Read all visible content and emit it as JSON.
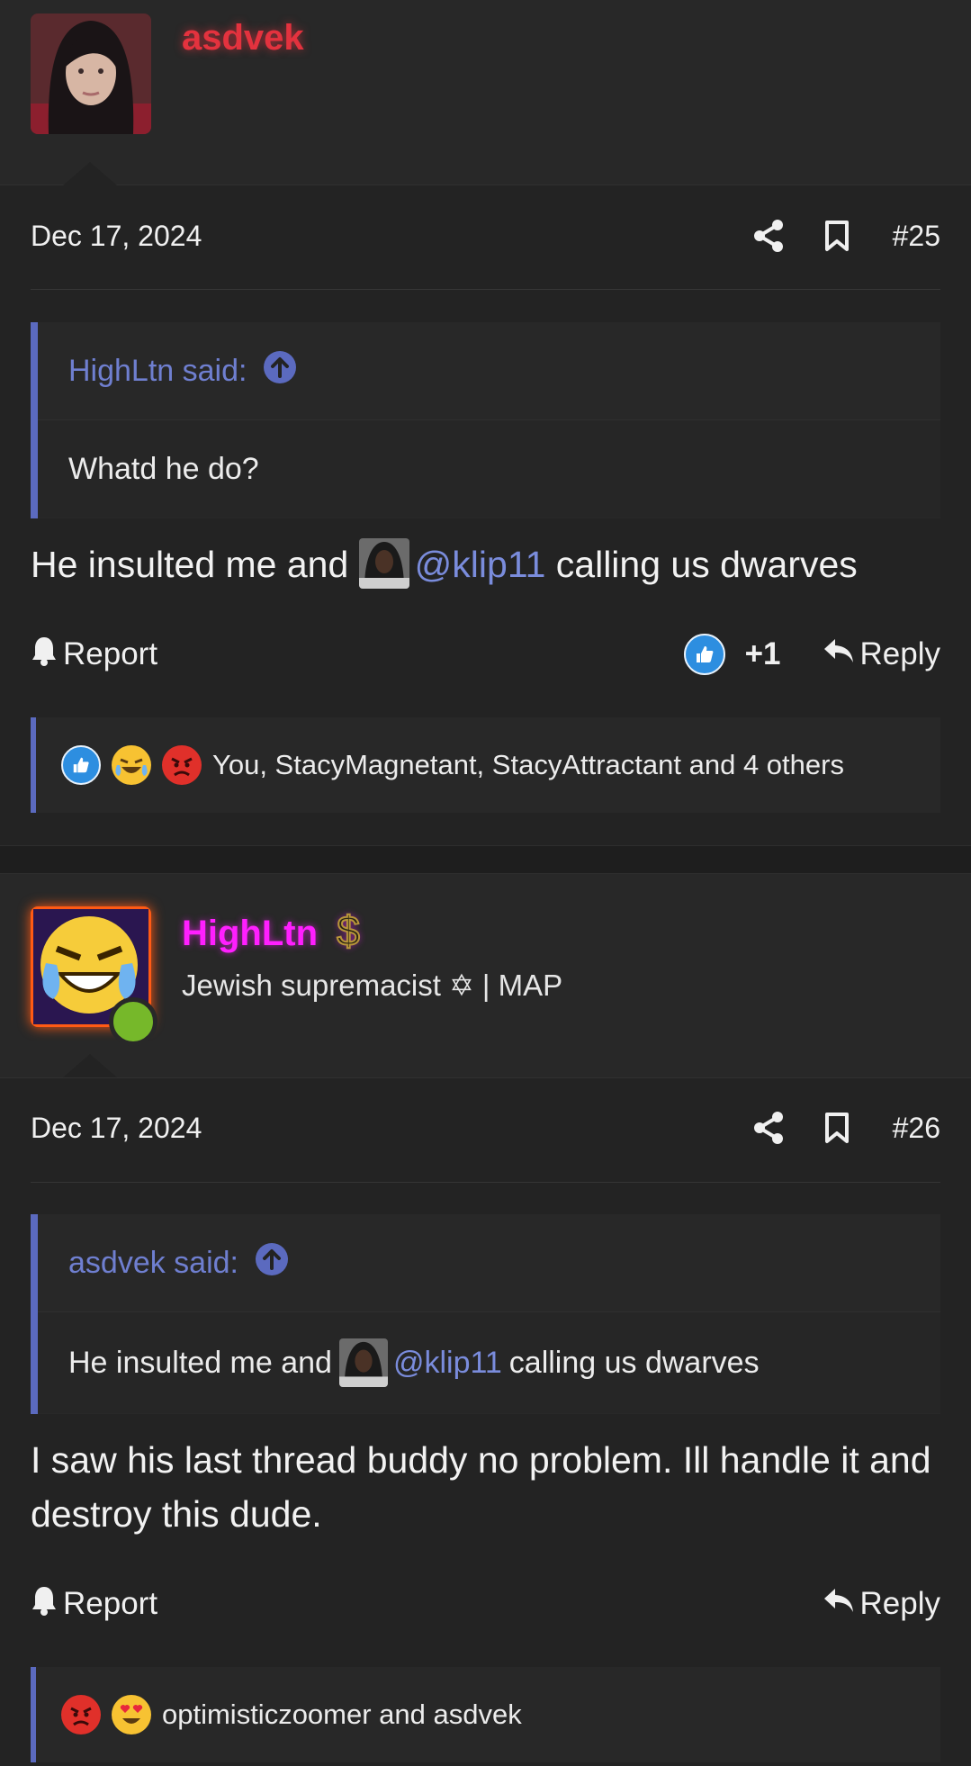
{
  "post1": {
    "username": "asdvek",
    "date": "Dec 17, 2024",
    "number": "#25",
    "quote": {
      "attribution": "HighLtn said:",
      "text": "Whatd he do?"
    },
    "body_before": "He insulted me and",
    "mention": "@klip11",
    "body_after": "calling us dwarves",
    "report_label": "Report",
    "reply_label": "Reply",
    "like_count": "+1",
    "reactions_text": "You, StacyMagnetant, StacyAttractant and 4 others"
  },
  "post2": {
    "username": "HighLtn",
    "dollar": "$",
    "user_title": "Jewish supremacist ✡ | MAP",
    "date": "Dec 17, 2024",
    "number": "#26",
    "quote": {
      "attribution": "asdvek said:",
      "text_before": "He insulted me and",
      "mention": "@klip11",
      "text_after": "calling us dwarves"
    },
    "body": "I saw his last thread buddy no problem. Ill handle it and destroy this dude.",
    "report_label": "Report",
    "reply_label": "Reply",
    "reactions_text": "optimisticzoomer and asdvek"
  },
  "colors": {
    "username_red": "#e3323e",
    "username_magenta": "#ff1fff",
    "accent_blue": "#5b6abf",
    "mention_blue": "#7a8cdc",
    "online_green": "#76b82a"
  },
  "icons": [
    "share-icon",
    "bookmark-icon",
    "arrow-up-circle-icon",
    "bell-icon",
    "reply-icon",
    "like-icon",
    "laugh-cry-icon",
    "angry-icon",
    "heart-eyes-icon"
  ]
}
